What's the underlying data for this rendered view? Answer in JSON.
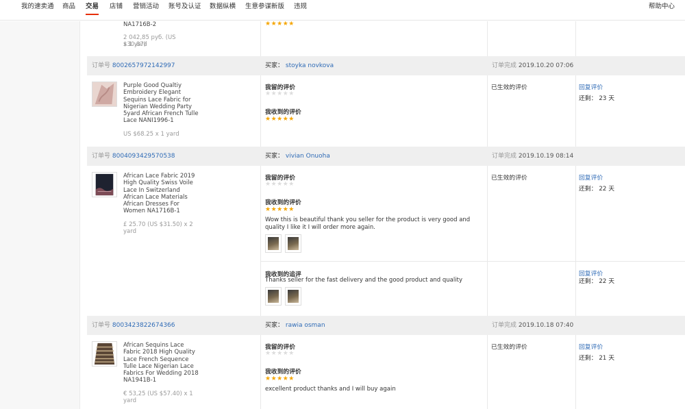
{
  "nav": {
    "items": [
      "我的速卖通",
      "商品",
      "交易",
      "店铺",
      "营销活动",
      "账号及认证",
      "数据纵横",
      "生意参谋新版",
      "违规"
    ],
    "active_index": 2,
    "help": "帮助中心"
  },
  "labels": {
    "order_no": "订单号",
    "buyer": "买家：",
    "completed": "订单完成",
    "left_review": "我留的评价",
    "received_review": "我收到的评价",
    "received_followup": "我收到的追评",
    "effective": "已生效的评价",
    "reply": "回复评价",
    "remaining": "还剩："
  },
  "colors": {
    "accent": "#e62e04",
    "link": "#2f6bb6",
    "star": "#f5a500"
  },
  "top_fragment": {
    "title_tail": "NA1716B-2",
    "price": "2 042,85 руб. (US $30.87)",
    "qty": "x 1 yard",
    "stars": "★★★★★"
  },
  "orders": [
    {
      "order_no": "8002657972142997",
      "buyer": "stoyka novkova",
      "date": "2019.10.20 07:06",
      "title": "Purple Good Qualtiy Embroidery Elegant Sequins Lace Fabric for Nigerian Wedding Party 5yard African French Tulle Lace NANI1996-1",
      "price": "US $68.25 x 1 yard",
      "left_stars": "★★★★★",
      "received_stars": "★★★★★",
      "remaining": "23 天"
    },
    {
      "order_no": "8004093429570538",
      "buyer": "vivian Onuoha",
      "date": "2019.10.19 08:14",
      "title": "African Lace Fabric 2019 High Quality Swiss Voile Lace In Switzerland African Lace Materials African Dresses For Women NA1716B-1",
      "price": "£ 25.70 (US $31.50) x 2 yard",
      "left_stars": "★★★★★",
      "received_stars": "★★★★★",
      "review_text": "Wow this is beautiful thank you seller for the product is very good and quality I like it I will order more again.",
      "followup_text": "Thanks seller for the fast delivery and the good product and quality",
      "remaining": "22 天",
      "followup_remaining": "22 天"
    },
    {
      "order_no": "8003423822674366",
      "buyer": "rawia osman",
      "date": "2019.10.18 07:40",
      "title": "African Sequins Lace Fabric 2018 High Quality Lace French Sequence Tulle Lace Nigerian Lace Fabrics For Wedding 2018 NA1941B-1",
      "price": "€ 53,25 (US $57.40) x 1 yard",
      "left_stars": "★★★★★",
      "received_stars": "★★★★★",
      "review_text": "excellent product thanks and I will buy again",
      "remaining": "21 天"
    }
  ]
}
